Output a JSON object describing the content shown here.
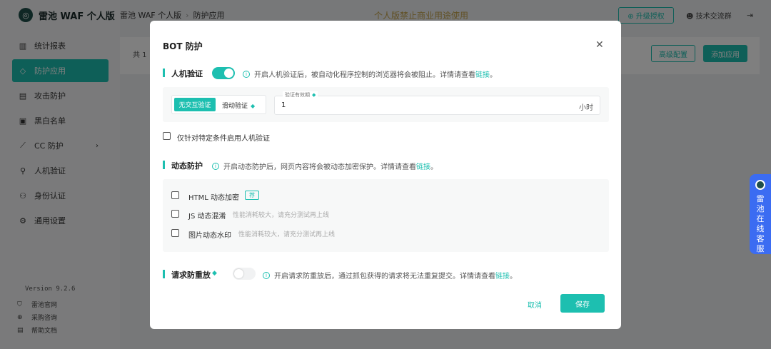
{
  "app": {
    "logo_text": "雷池 WAF 个人版",
    "logo_glyph": "◎",
    "version": "Version 9.2.6"
  },
  "sidebar": {
    "items": [
      {
        "label": "统计报表",
        "icon": "chart-icon",
        "glyph": "▥",
        "active": false
      },
      {
        "label": "防护应用",
        "icon": "shield-icon",
        "glyph": "◇",
        "active": true
      },
      {
        "label": "攻击防护",
        "icon": "attack-icon",
        "glyph": "▤",
        "active": false
      },
      {
        "label": "黑白名单",
        "icon": "list-icon",
        "glyph": "▣",
        "active": false
      },
      {
        "label": "CC 防护",
        "icon": "cc-icon",
        "glyph": "⟋",
        "active": false,
        "chevron": "›"
      },
      {
        "label": "人机验证",
        "icon": "person-icon",
        "glyph": "⚲",
        "active": false
      },
      {
        "label": "身份认证",
        "icon": "identity-icon",
        "glyph": "⚇",
        "active": false
      },
      {
        "label": "通用设置",
        "icon": "settings-icon",
        "glyph": "⚙",
        "active": false
      }
    ],
    "footer_links": [
      {
        "label": "雷池官网",
        "icon": "official-site-icon",
        "glyph": "⛉"
      },
      {
        "label": "采购咨询",
        "icon": "purchase-icon",
        "glyph": "⊕"
      },
      {
        "label": "帮助文档",
        "icon": "help-doc-icon",
        "glyph": "▤"
      }
    ]
  },
  "topbar": {
    "breadcrumb": [
      "雷池 WAF 个人版",
      "防护应用"
    ],
    "crumb_sep": "›",
    "notice": "个人版禁止商业用途使用",
    "upgrade_label": "⊕ 升级授权",
    "community_label": "技术交流群",
    "community_glyph": "☻",
    "logout_glyph": "⇥"
  },
  "content": {
    "total_text": "共 1",
    "advanced_btn": "高级配置",
    "add_btn": "添加应用"
  },
  "float_cs": {
    "text": "雷池在线客服"
  },
  "modal": {
    "title": "BOT 防护",
    "close_glyph": "✕",
    "captcha": {
      "title": "人机验证",
      "enabled": true,
      "info": "开启人机验证后，被自动化程序控制的浏览器将会被阻止。详情请查看",
      "link": "链接",
      "info_end": "。",
      "mode_active": "无交互验证",
      "mode_other": "滑动验证",
      "valid_label": "验证有效期",
      "valid_value": "1",
      "valid_unit": "小时",
      "specific_label": "仅针对特定条件启用人机验证"
    },
    "dynamic": {
      "title": "动态防护",
      "info": "开启动态防护后，网页内容将会被动态加密保护。详情请查看",
      "link": "链接",
      "info_end": "。",
      "options": [
        {
          "label": "HTML 动态加密",
          "badge": "荐",
          "hint": ""
        },
        {
          "label": "JS 动态混淆",
          "badge": "",
          "hint": "性能消耗较大，请充分测试再上线"
        },
        {
          "label": "图片动态水印",
          "badge": "",
          "hint": "性能消耗较大，请充分测试再上线"
        }
      ]
    },
    "replay": {
      "title": "请求防重放",
      "enabled": false,
      "info": "开启请求防重放后，通过抓包获得的请求将无法重复提交。详情请查看",
      "link": "链接",
      "info_end": "。"
    },
    "cancel_label": "取消",
    "save_label": "保存"
  },
  "colors": {
    "accent": "#1dbfb0",
    "float_cs": "#3b6cf2",
    "notice": "#c4a24b"
  }
}
